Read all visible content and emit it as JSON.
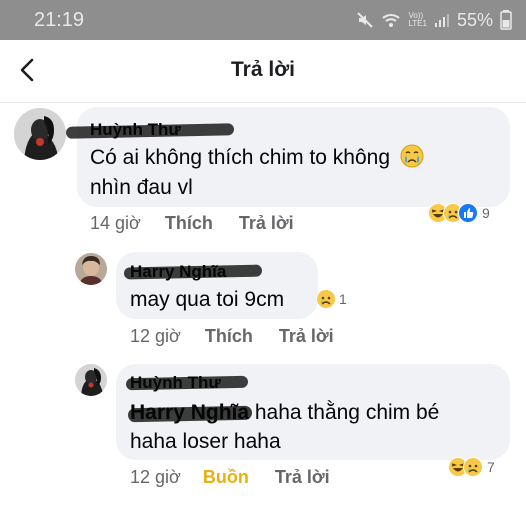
{
  "status_bar": {
    "time": "21:19",
    "network": "Vo))\nLTE1",
    "battery": "55%"
  },
  "header": {
    "title": "Trả lời"
  },
  "comment": {
    "author": "Huỳnh Thư",
    "text_line1": "Có ai không thích chim to không",
    "text_line2": "nhìn đau vl",
    "time": "14 giờ",
    "like": "Thích",
    "reply": "Trả lời",
    "reaction_count": "9"
  },
  "reply1": {
    "author": "Harry Nghĩa",
    "text": "may qua toi 9cm",
    "reaction_count": "1",
    "time": "12 giờ",
    "like": "Thích",
    "reply": "Trả lời"
  },
  "reply2": {
    "author": "Huỳnh Thư",
    "mention": "Harry Nghĩa",
    "text_line1": " haha thằng chim bé",
    "text_line2": "haha loser haha",
    "time": "12 giờ",
    "reaction_label": "Buồn",
    "reply": "Trả lời",
    "reaction_count": "7"
  },
  "colors": {
    "sad_reaction": "#e9b10f",
    "like_blue": "#1877f2",
    "bubble": "#f0f2f5",
    "status_bar": "#8e8e8e"
  },
  "icons": {
    "back": "chevron-left",
    "haha": "laughing-emoji",
    "sad": "crying-emoji",
    "like": "thumbs-up",
    "cry_inline": "crying-emoji"
  }
}
